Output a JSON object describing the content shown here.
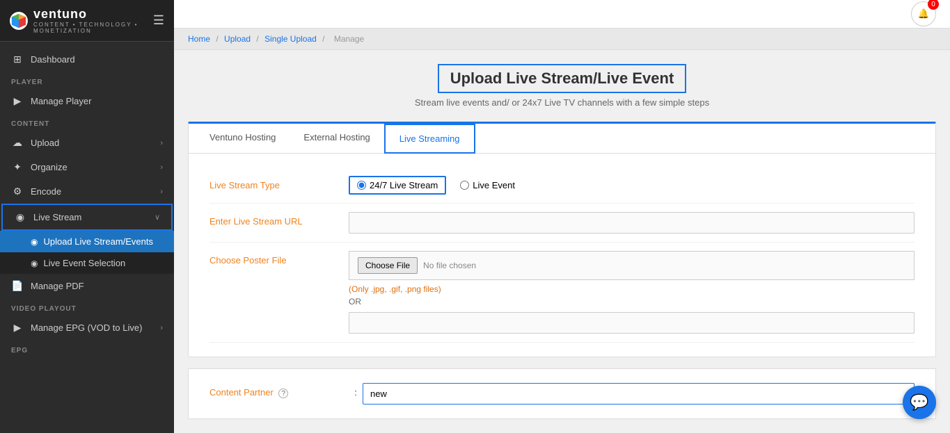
{
  "sidebar": {
    "logo": {
      "text": "ventuno",
      "sub": "CONTENT • TECHNOLOGY • MONETIZATION"
    },
    "nav": [
      {
        "id": "dashboard",
        "label": "Dashboard",
        "icon": "⊞",
        "active": false
      },
      {
        "id": "player-section",
        "label": "PLAYER",
        "type": "section"
      },
      {
        "id": "manage-player",
        "label": "Manage Player",
        "icon": "▶",
        "active": false
      },
      {
        "id": "content-section",
        "label": "CONTENT",
        "type": "section"
      },
      {
        "id": "upload",
        "label": "Upload",
        "icon": "☁",
        "active": false,
        "hasArrow": true
      },
      {
        "id": "organize",
        "label": "Organize",
        "icon": "✦",
        "active": false,
        "hasArrow": true
      },
      {
        "id": "encode",
        "label": "Encode",
        "icon": "⚙",
        "active": false,
        "hasArrow": true
      },
      {
        "id": "live-stream",
        "label": "Live Stream",
        "icon": "◉",
        "active": false,
        "hasArrow": true,
        "highlighted": true
      },
      {
        "id": "upload-live-stream",
        "label": "Upload Live Stream/Events",
        "icon": "◉",
        "active": true,
        "sub": true
      },
      {
        "id": "live-event-selection",
        "label": "Live Event Selection",
        "icon": "◉",
        "active": false,
        "sub": true
      },
      {
        "id": "manage-pdf",
        "label": "Manage PDF",
        "icon": "📄",
        "active": false
      },
      {
        "id": "video-playout-section",
        "label": "VIDEO PLAYOUT",
        "type": "section"
      },
      {
        "id": "manage-epg",
        "label": "Manage EPG (VOD to Live)",
        "icon": "▶",
        "active": false,
        "hasArrow": true
      },
      {
        "id": "epg-section",
        "label": "EPG",
        "type": "section"
      }
    ]
  },
  "topbar": {
    "notif_count": "0"
  },
  "breadcrumb": {
    "home": "Home",
    "upload": "Upload",
    "single_upload": "Single Upload",
    "manage": "Manage"
  },
  "page": {
    "title": "Upload Live Stream/Live Event",
    "subtitle": "Stream live events and/ or 24x7 Live TV channels with a few simple steps"
  },
  "tabs": [
    {
      "id": "ventuno-hosting",
      "label": "Ventuno Hosting",
      "active": false
    },
    {
      "id": "external-hosting",
      "label": "External Hosting",
      "active": false
    },
    {
      "id": "live-streaming",
      "label": "Live Streaming",
      "active": true
    }
  ],
  "form": {
    "live_stream_type_label": "Live Stream Type",
    "option_247": "24/7 Live Stream",
    "option_live_event": "Live Event",
    "enter_url_label": "Enter Live Stream URL",
    "enter_url_placeholder": "",
    "choose_poster_label": "Choose Poster File",
    "choose_file_btn": "Choose File",
    "no_file_chosen": "No file chosen",
    "file_hint": "(Only .jpg, .gif, .png files)",
    "or_label": "OR",
    "content_partner_label": "Content Partner",
    "content_partner_value": "new",
    "content_partner_placeholder": "new"
  },
  "chat": {
    "icon": "💬"
  }
}
